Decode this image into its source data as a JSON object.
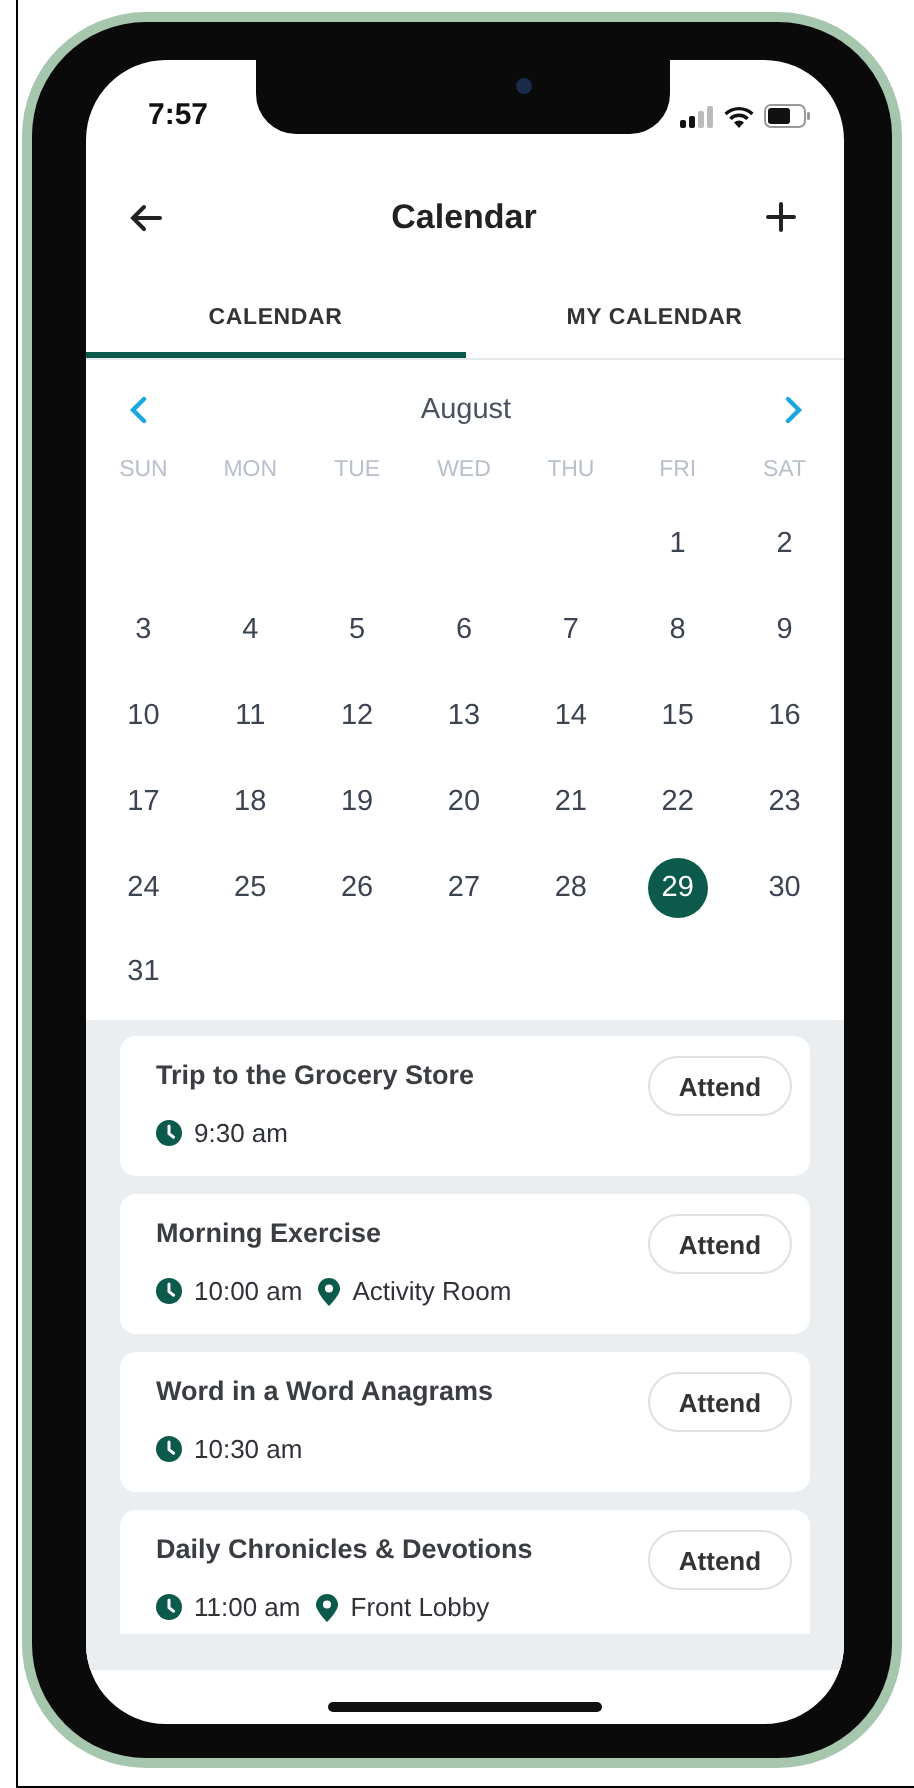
{
  "status_bar": {
    "time": "7:57"
  },
  "header": {
    "title": "Calendar"
  },
  "tabs": [
    {
      "label": "CALENDAR",
      "selected": true
    },
    {
      "label": "MY CALENDAR",
      "selected": false
    }
  ],
  "calendar": {
    "month": "August",
    "weekdays": [
      "SUN",
      "MON",
      "TUE",
      "WED",
      "THU",
      "FRI",
      "SAT"
    ],
    "weeks": [
      [
        {
          "label": "1",
          "selected": false
        },
        {
          "label": "2",
          "selected": false
        }
      ],
      [
        {
          "label": "3",
          "selected": false
        },
        {
          "label": "4",
          "selected": false
        },
        {
          "label": "5",
          "selected": false
        },
        {
          "label": "6",
          "selected": false
        },
        {
          "label": "7",
          "selected": false
        },
        {
          "label": "8",
          "selected": false
        },
        {
          "label": "9",
          "selected": false
        }
      ],
      [
        {
          "label": "10",
          "selected": false
        },
        {
          "label": "11",
          "selected": false
        },
        {
          "label": "12",
          "selected": false
        },
        {
          "label": "13",
          "selected": false
        },
        {
          "label": "14",
          "selected": false
        },
        {
          "label": "15",
          "selected": false
        },
        {
          "label": "16",
          "selected": false
        }
      ],
      [
        {
          "label": "17",
          "selected": false
        },
        {
          "label": "18",
          "selected": false
        },
        {
          "label": "19",
          "selected": false
        },
        {
          "label": "20",
          "selected": false
        },
        {
          "label": "21",
          "selected": false
        },
        {
          "label": "22",
          "selected": false
        },
        {
          "label": "23",
          "selected": false
        }
      ],
      [
        {
          "label": "24",
          "selected": false
        },
        {
          "label": "25",
          "selected": false
        },
        {
          "label": "26",
          "selected": false
        },
        {
          "label": "27",
          "selected": false
        },
        {
          "label": "28",
          "selected": false
        },
        {
          "label": "29",
          "selected": true
        },
        {
          "label": "30",
          "selected": false
        }
      ],
      [
        {
          "label": "31",
          "selected": false
        }
      ]
    ]
  },
  "events": [
    {
      "title": "Trip to the Grocery Store",
      "time": "9:30 am",
      "button": "Attend"
    },
    {
      "title": "Morning Exercise",
      "time": "10:00 am",
      "location": "Activity Room",
      "button": "Attend"
    },
    {
      "title": "Word in a Word Anagrams",
      "time": "10:30 am",
      "button": "Attend"
    },
    {
      "title": "Daily Chronicles & Devotions",
      "time": "11:00 am",
      "location": "Front Lobby",
      "button": "Attend"
    }
  ]
}
